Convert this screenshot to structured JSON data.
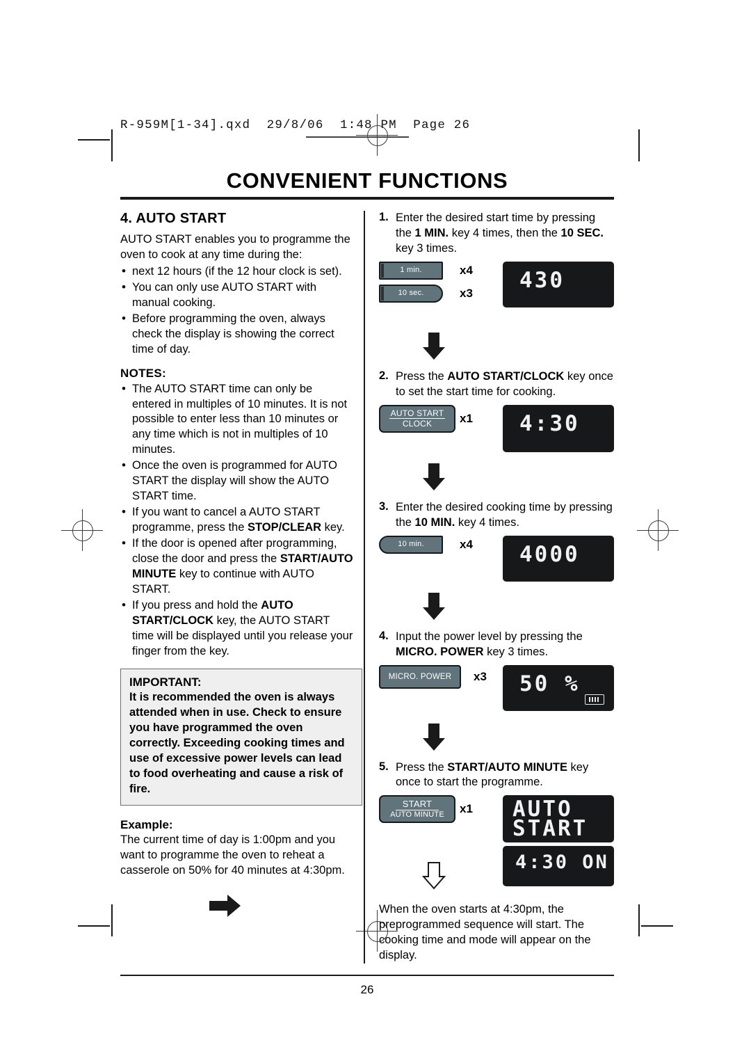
{
  "file_header": "R-959M[1-34].qxd  29/8/06  1:48 PM  Page 26",
  "title": "CONVENIENT FUNCTIONS",
  "page_number": "26",
  "left": {
    "section_heading": "4.  AUTO START",
    "intro": "AUTO START enables you to programme the oven to cook at any time during the:",
    "intro_bullets": [
      "next 12 hours (if the 12 hour clock is set).",
      "You can only use AUTO START with manual cooking.",
      "Before programming the oven, always check the display is showing the correct time of day."
    ],
    "notes_heading": "NOTES:",
    "notes": [
      "The AUTO START time can only be entered in multiples of 10 minutes. It is not possible to enter less than 10 minutes or any time which is not in multiples of 10 minutes.",
      "Once the oven is programmed for AUTO START the display will show the AUTO START time.",
      "If you want to cancel a AUTO START programme, press the STOP/CLEAR key.",
      "If the door is opened after programming, close the door and press the START/AUTO MINUTE key to continue with AUTO START.",
      "If you press and hold the AUTO START/CLOCK key, the AUTO START time will be displayed until you release your finger from the key."
    ],
    "important_heading": "IMPORTANT:",
    "important_body": "It is recommended the oven is always attended when in use. Check to ensure you have programmed the oven correctly. Exceeding cooking times and use of excessive power levels can lead to food overheating and cause a risk of fire.",
    "example_heading": "Example:",
    "example_body": "The current time of day is 1:00pm and you want to programme the oven to reheat a casserole on 50% for 40 minutes at 4:30pm."
  },
  "right": {
    "steps": [
      {
        "num": "1.",
        "text": "Enter the desired start time by pressing the 1 MIN. key 4 times, then the 10 SEC. key 3 times.",
        "keys": [
          {
            "label": "1 min.",
            "multiplier": "x4"
          },
          {
            "label": "10 sec.",
            "multiplier": "x3"
          }
        ],
        "display": "430"
      },
      {
        "num": "2.",
        "text": "Press the AUTO START/CLOCK key once to set the start time for cooking.",
        "keys": [
          {
            "label_line1": "AUTO START",
            "label_line2": "CLOCK",
            "multiplier": "x1"
          }
        ],
        "display": "4:30"
      },
      {
        "num": "3.",
        "text": "Enter the desired cooking time by pressing the 10 MIN. key 4 times.",
        "keys": [
          {
            "label": "10 min.",
            "multiplier": "x4"
          }
        ],
        "display": "4000"
      },
      {
        "num": "4.",
        "text": "Input the power level by pressing the MICRO. POWER key 3 times.",
        "keys": [
          {
            "label": "MICRO. POWER",
            "multiplier": "x3"
          }
        ],
        "display": "50 %",
        "indicator": "microwave-icon"
      },
      {
        "num": "5.",
        "text": "Press the START/AUTO MINUTE key once to start the programme.",
        "keys": [
          {
            "label_line1": "START",
            "label_line2": "AUTO MINUTE",
            "multiplier": "x1"
          }
        ],
        "display_line1": "AUTO",
        "display_line2": "START",
        "display_second": "4:30 ON"
      }
    ],
    "closing": "When the oven starts at 4:30pm, the preprogrammed sequence will start. The cooking time and mode will appear on the display."
  }
}
